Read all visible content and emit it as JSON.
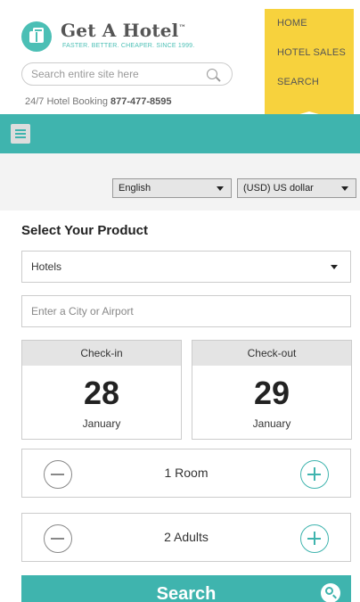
{
  "header": {
    "logo_title": "Get A Hotel",
    "logo_tm": "™",
    "tagline": "FASTER. BETTER. CHEAPER. SINCE 1999.",
    "search_placeholder": "Search entire site here",
    "phone_label": "24/7 Hotel Booking",
    "phone_number": "877-477-8595"
  },
  "nav": {
    "items": [
      {
        "label": "HOME"
      },
      {
        "label": "HOTEL SALES"
      },
      {
        "label": "SEARCH"
      }
    ]
  },
  "locale": {
    "language": "English",
    "currency": "(USD) US dollar"
  },
  "product": {
    "title": "Select Your Product",
    "selected": "Hotels",
    "city_placeholder": "Enter a City or Airport"
  },
  "dates": {
    "checkin": {
      "label": "Check-in",
      "day": "28",
      "month": "January"
    },
    "checkout": {
      "label": "Check-out",
      "day": "29",
      "month": "January"
    }
  },
  "rooms": {
    "label": "1 Room"
  },
  "adults": {
    "label": "2 Adults"
  },
  "search_button": {
    "label": "Search"
  },
  "colors": {
    "accent": "#3fb4ae",
    "banner": "#f7d23d"
  }
}
